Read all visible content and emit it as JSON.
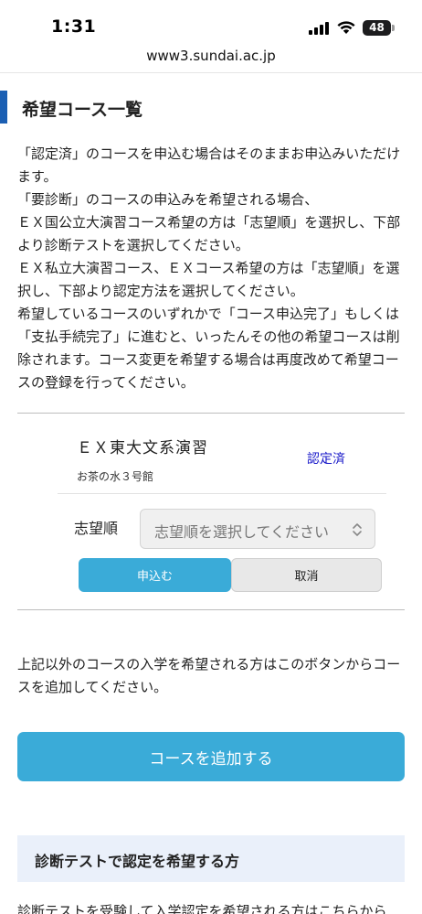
{
  "status_bar": {
    "time": "1:31",
    "battery_level": "48"
  },
  "browser": {
    "url": "www3.sundai.ac.jp"
  },
  "section": {
    "title": "希望コース一覧"
  },
  "intro": {
    "lines": [
      "「認定済」のコースを申込む場合はそのままお申込みいただけます。",
      "「要診断」のコースの申込みを希望される場合、",
      "ＥＸ国公立大演習コース希望の方は「志望順」を選択し、下部より診断テストを選択してください。",
      "ＥＸ私立大演習コース、ＥＸコース希望の方は「志望順」を選択し、下部より認定方法を選択してください。",
      "希望しているコースのいずれかで「コース申込完了」もしくは「支払手続完了」に進むと、いったんその他の希望コースは削除されます。コース変更を希望する場合は再度改めて希望コースの登録を行ってください。"
    ]
  },
  "course": {
    "name": "ＥＸ東大文系演習",
    "location": "お茶の水３号館",
    "status": "認定済",
    "preference_label": "志望順",
    "preference_placeholder": "志望順を選択してください",
    "apply_label": "申込む",
    "cancel_label": "取消"
  },
  "add_course": {
    "note": "上記以外のコースの入学を希望される方はこのボタンからコースを追加してください。",
    "button_label": "コースを追加する"
  },
  "diagnosis": {
    "title": "診断テストで認定を希望する方",
    "description": "診断テストを受験して入学認定を希望される方はこちらから"
  },
  "colors": {
    "accent": "#3aabd8",
    "heading_bar": "#1b5fb3",
    "status_link": "#1414c8",
    "diag_background": "#eaf0fa"
  }
}
